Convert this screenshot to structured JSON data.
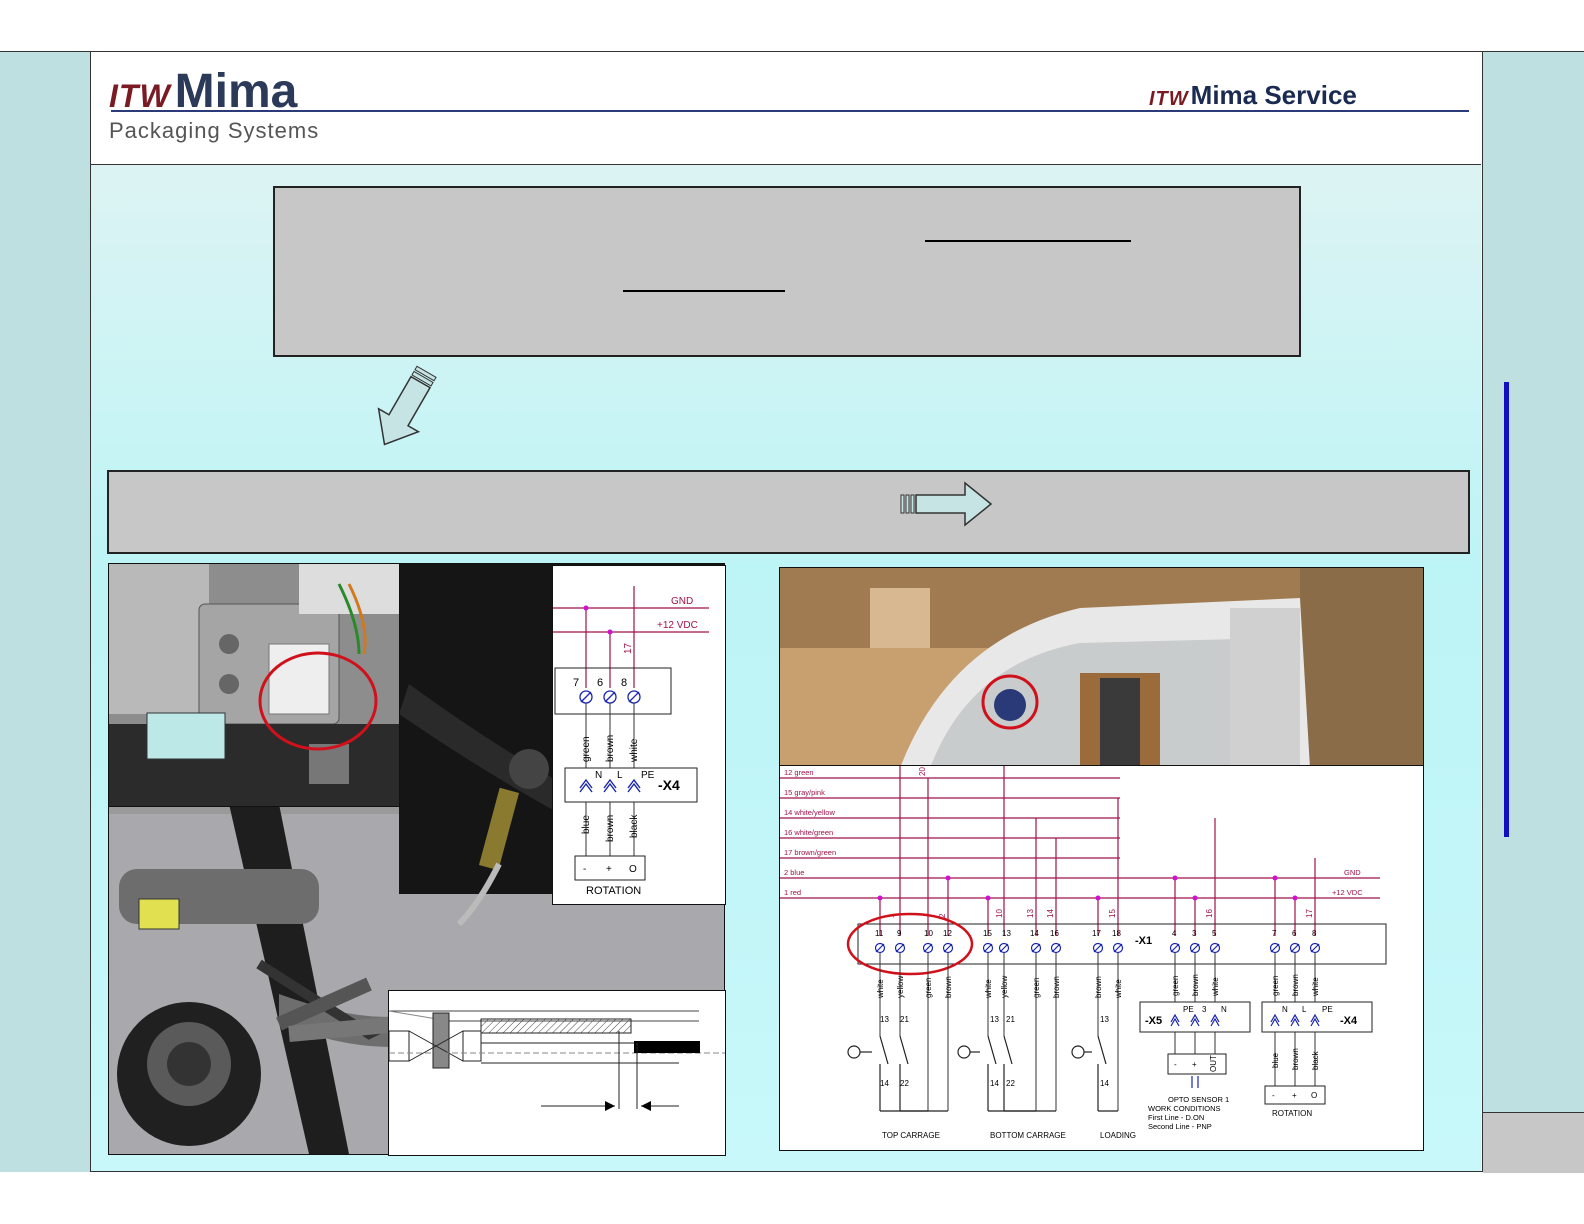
{
  "header": {
    "logo_left_prefix": "ITW",
    "logo_left_main": "Mima",
    "logo_left_sub": "Packaging Systems",
    "logo_right_prefix": "ITW",
    "logo_right_main": "Mima Service"
  },
  "rotation_schematic": {
    "gnd": "GND",
    "vdc": "+12 VDC",
    "wire_17": "17",
    "terminals": [
      "7",
      "6",
      "8"
    ],
    "wires_top": [
      "green",
      "brown",
      "white"
    ],
    "x4_pins": [
      "N",
      "L",
      "PE"
    ],
    "x4_label": "-X4",
    "wires_bottom": [
      "blue",
      "brown",
      "black"
    ],
    "sensor_pins": [
      "-",
      "+",
      "O"
    ],
    "sensor_label": "ROTATION"
  },
  "main_schematic": {
    "signal_labels": [
      "12 green",
      "15 gray/pink",
      "14 white/yellow",
      "16 white/green",
      "17 brown/green",
      "2 blue",
      "1 red"
    ],
    "gnd": "GND",
    "vdc": "+12 VDC",
    "vertical_wire_labels": [
      "1",
      "2",
      "10",
      "13",
      "14",
      "15",
      "16",
      "17",
      "20"
    ],
    "x1_terminals": [
      "11",
      "9",
      "10",
      "12",
      "15",
      "13",
      "14",
      "16",
      "17",
      "18",
      "4",
      "3",
      "5",
      "7",
      "6",
      "8"
    ],
    "x1_label": "-X1",
    "wire_colors_top_carrage": [
      "white",
      "yellow",
      "green",
      "brown"
    ],
    "wire_colors_bottom_carrage": [
      "white",
      "yellow",
      "green",
      "brown"
    ],
    "wire_colors_loading": [
      "brown",
      "white"
    ],
    "wire_colors_x5": [
      "green",
      "brown",
      "white"
    ],
    "wire_colors_x4_top": [
      "green",
      "brown",
      "white"
    ],
    "wire_colors_x4_bottom": [
      "blue",
      "brown",
      "black"
    ],
    "switch_numbers_top": [
      "13",
      "21",
      "13",
      "21",
      "13"
    ],
    "switch_numbers_bottom": [
      "14",
      "22",
      "14",
      "22",
      "14"
    ],
    "x5_pins": [
      "PE",
      "3",
      "N"
    ],
    "x5_label": "-X5",
    "x4_pins": [
      "N",
      "L",
      "PE"
    ],
    "x4_label": "-X4",
    "opto_pins": [
      "-",
      "+",
      "OUT"
    ],
    "rotation_pins": [
      "-",
      "+",
      "O"
    ],
    "label_top_carrage": "TOP CARRAGE",
    "label_bottom_carrage": "BOTTOM CARRAGE",
    "label_loading": "LOADING",
    "opto_title": "OPTO SENSOR 1",
    "opto_line1": "WORK CONDITIONS",
    "opto_line2": "First Line - D.ON",
    "opto_line3": "Second Line - PNP",
    "label_rotation": "ROTATION"
  },
  "colors": {
    "accent_red": "#d0101a",
    "wire_magenta": "#a0124a",
    "schematic_blue": "#1a25b0",
    "side_band": "#bfe0e0",
    "grey_box": "#c7c7c7",
    "right_bar": "#1010c0"
  }
}
